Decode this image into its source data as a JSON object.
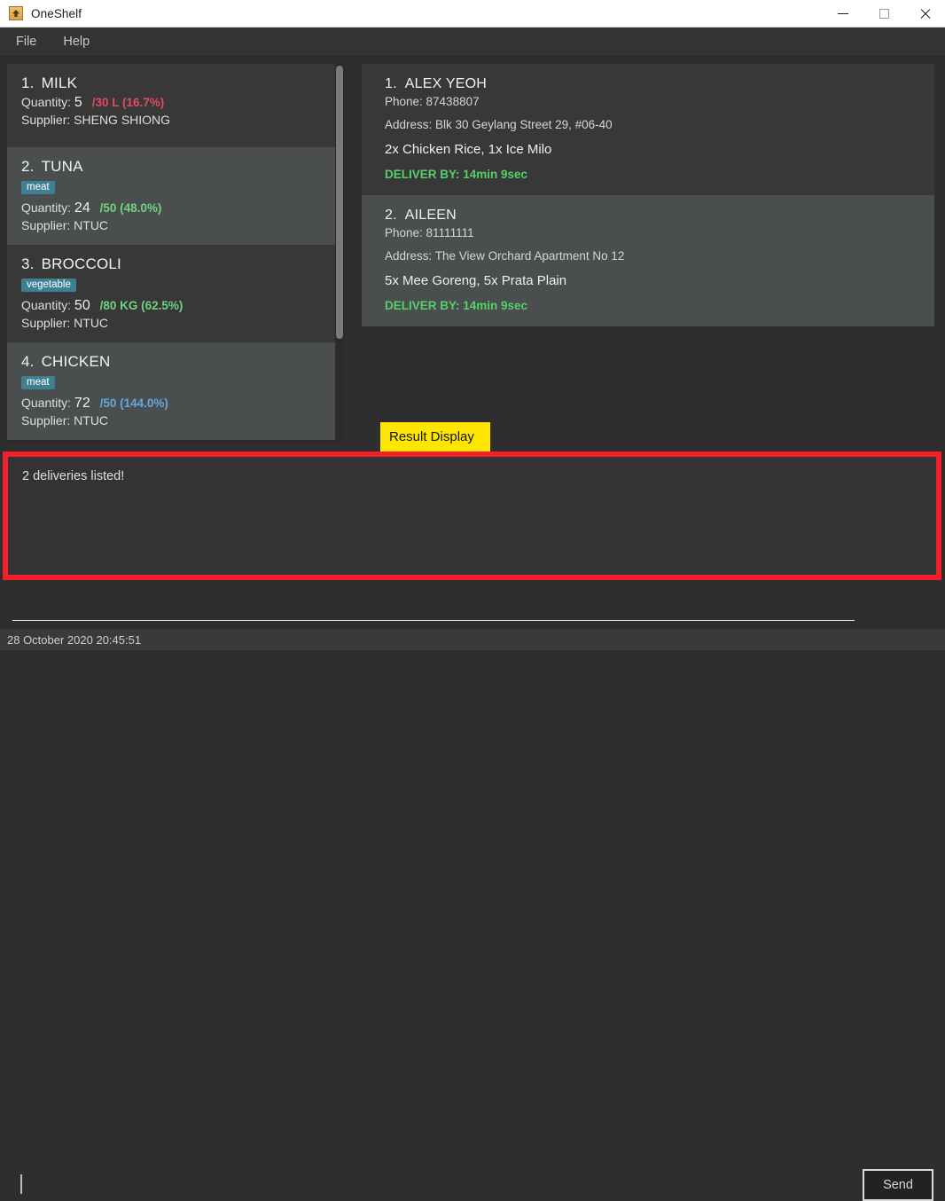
{
  "window": {
    "title": "OneShelf",
    "icon": "app-icon",
    "controls": {
      "minimize": "minimize-icon",
      "maximize": "maximize-icon",
      "close": "close-icon"
    }
  },
  "menubar": {
    "items": [
      {
        "label": "File"
      },
      {
        "label": "Help"
      }
    ]
  },
  "stock_panel": {
    "items": [
      {
        "index": "1.",
        "name": "MILK",
        "tag": null,
        "quantity_label": "Quantity:",
        "quantity": "5",
        "ratio": "/30 L (16.7%)",
        "ratio_state": "low",
        "supplier_label": "Supplier:",
        "supplier": "SHENG SHIONG",
        "selected": false
      },
      {
        "index": "2.",
        "name": "TUNA",
        "tag": "meat",
        "quantity_label": "Quantity:",
        "quantity": "24",
        "ratio": "/50 (48.0%)",
        "ratio_state": "ok",
        "supplier_label": "Supplier:",
        "supplier": "NTUC",
        "selected": true
      },
      {
        "index": "3.",
        "name": "BROCCOLI",
        "tag": "vegetable",
        "quantity_label": "Quantity:",
        "quantity": "50",
        "ratio": "/80 KG (62.5%)",
        "ratio_state": "ok",
        "supplier_label": "Supplier:",
        "supplier": "NTUC",
        "selected": false
      },
      {
        "index": "4.",
        "name": "CHICKEN",
        "tag": "meat",
        "quantity_label": "Quantity:",
        "quantity": "72",
        "ratio": "/50 (144.0%)",
        "ratio_state": "over",
        "supplier_label": "Supplier:",
        "supplier": "NTUC",
        "selected": true
      }
    ]
  },
  "delivery_panel": {
    "items": [
      {
        "index": "1.",
        "name": "ALEX YEOH",
        "phone": "Phone: 87438807",
        "address": "Address: Blk 30 Geylang Street 29, #06-40",
        "order": "2x Chicken Rice, 1x Ice Milo",
        "deliver_by": "DELIVER BY: 14min 9sec",
        "selected": false
      },
      {
        "index": "2.",
        "name": "AILEEN",
        "phone": "Phone: 81111111",
        "address": "Address: The View Orchard Apartment No 12",
        "order": "5x Mee Goreng, 5x Prata Plain",
        "deliver_by": "DELIVER BY: 14min 9sec",
        "selected": true
      }
    ]
  },
  "result_display": {
    "annotation_label": "Result Display",
    "text": "2 deliveries listed!",
    "highlight_color": "#f32029",
    "annotation_color": "#ffe600"
  },
  "command_bar": {
    "value": "",
    "placeholder": "",
    "send_label": "Send"
  },
  "statusbar": {
    "text": "28 October 2020 20:45:51"
  },
  "colors": {
    "window_bg": "#2e2e2e",
    "card_bg": "#383838",
    "card_selected_bg": "#4a4e4e",
    "tag_bg": "#3f7f93",
    "low": "#e24a63",
    "ok": "#6fd47e",
    "over": "#63a8dd",
    "deliver": "#55d06a"
  }
}
